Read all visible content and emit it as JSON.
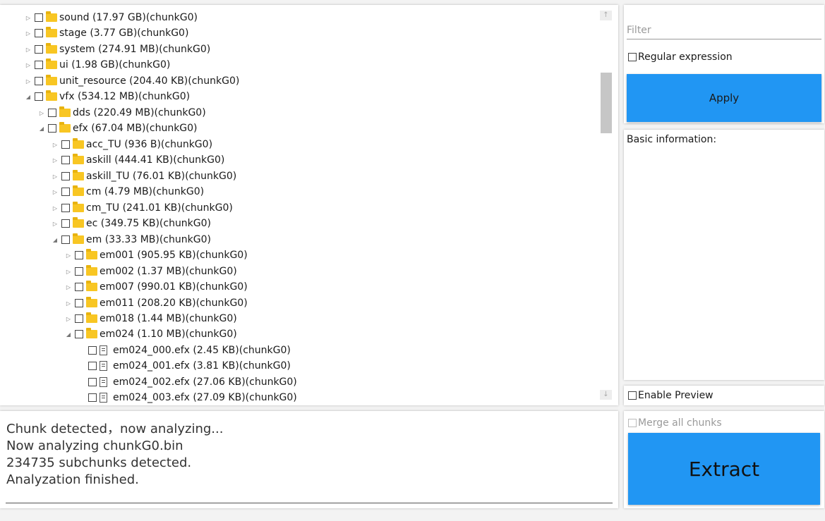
{
  "tree": {
    "rows": [
      {
        "label": "sound (17.97 GB)(chunkG0)",
        "type": "folder",
        "expander": "▷"
      },
      {
        "label": "stage (3.77 GB)(chunkG0)",
        "type": "folder",
        "expander": "▷"
      },
      {
        "label": "system (274.91 MB)(chunkG0)",
        "type": "folder",
        "expander": "▷"
      },
      {
        "label": "ui (1.98 GB)(chunkG0)",
        "type": "folder",
        "expander": "▷"
      },
      {
        "label": "unit_resource (204.40 KB)(chunkG0)",
        "type": "folder",
        "expander": "▷"
      },
      {
        "label": "vfx (534.12 MB)(chunkG0)",
        "type": "folder",
        "expander": "◢"
      },
      {
        "label": "dds (220.49 MB)(chunkG0)",
        "type": "folder",
        "expander": "▷"
      },
      {
        "label": "efx (67.04 MB)(chunkG0)",
        "type": "folder",
        "expander": "◢"
      },
      {
        "label": "acc_TU (936 B)(chunkG0)",
        "type": "folder",
        "expander": "▷"
      },
      {
        "label": "askill (444.41 KB)(chunkG0)",
        "type": "folder",
        "expander": "▷"
      },
      {
        "label": "askill_TU (76.01 KB)(chunkG0)",
        "type": "folder",
        "expander": "▷"
      },
      {
        "label": "cm (4.79 MB)(chunkG0)",
        "type": "folder",
        "expander": "▷"
      },
      {
        "label": "cm_TU (241.01 KB)(chunkG0)",
        "type": "folder",
        "expander": "▷"
      },
      {
        "label": "ec (349.75 KB)(chunkG0)",
        "type": "folder",
        "expander": "▷"
      },
      {
        "label": "em (33.33 MB)(chunkG0)",
        "type": "folder",
        "expander": "◢"
      },
      {
        "label": "em001 (905.95 KB)(chunkG0)",
        "type": "folder",
        "expander": "▷"
      },
      {
        "label": "em002 (1.37 MB)(chunkG0)",
        "type": "folder",
        "expander": "▷"
      },
      {
        "label": "em007 (990.01 KB)(chunkG0)",
        "type": "folder",
        "expander": "▷"
      },
      {
        "label": "em011 (208.20 KB)(chunkG0)",
        "type": "folder",
        "expander": "▷"
      },
      {
        "label": "em018 (1.44 MB)(chunkG0)",
        "type": "folder",
        "expander": "▷"
      },
      {
        "label": "em024 (1.10 MB)(chunkG0)",
        "type": "folder",
        "expander": "◢"
      },
      {
        "label": "em024_000.efx (2.45 KB)(chunkG0)",
        "type": "file",
        "expander": ""
      },
      {
        "label": "em024_001.efx (3.81 KB)(chunkG0)",
        "type": "file",
        "expander": ""
      },
      {
        "label": "em024_002.efx (27.06 KB)(chunkG0)",
        "type": "file",
        "expander": ""
      },
      {
        "label": "em024_003.efx (27.09 KB)(chunkG0)",
        "type": "file",
        "expander": ""
      }
    ],
    "scroll_up_arrow": "↑",
    "scroll_down_arrow": "↓"
  },
  "filter": {
    "placeholder": "Filter",
    "value": "",
    "regex_label": "Regular expression",
    "regex_checked": false,
    "apply_label": "Apply"
  },
  "info": {
    "title": "Basic information:"
  },
  "preview": {
    "label": "Enable Preview",
    "checked": false
  },
  "log": {
    "lines": [
      "Chunk detected，now analyzing...",
      "Now analyzing chunkG0.bin",
      "234735 subchunks detected.",
      "Analyzation finished."
    ]
  },
  "extract": {
    "merge_label": "Merge all chunks",
    "merge_enabled": false,
    "button_label": "Extract"
  },
  "colors": {
    "accent": "#2196f3",
    "folder": "#f8c623"
  }
}
